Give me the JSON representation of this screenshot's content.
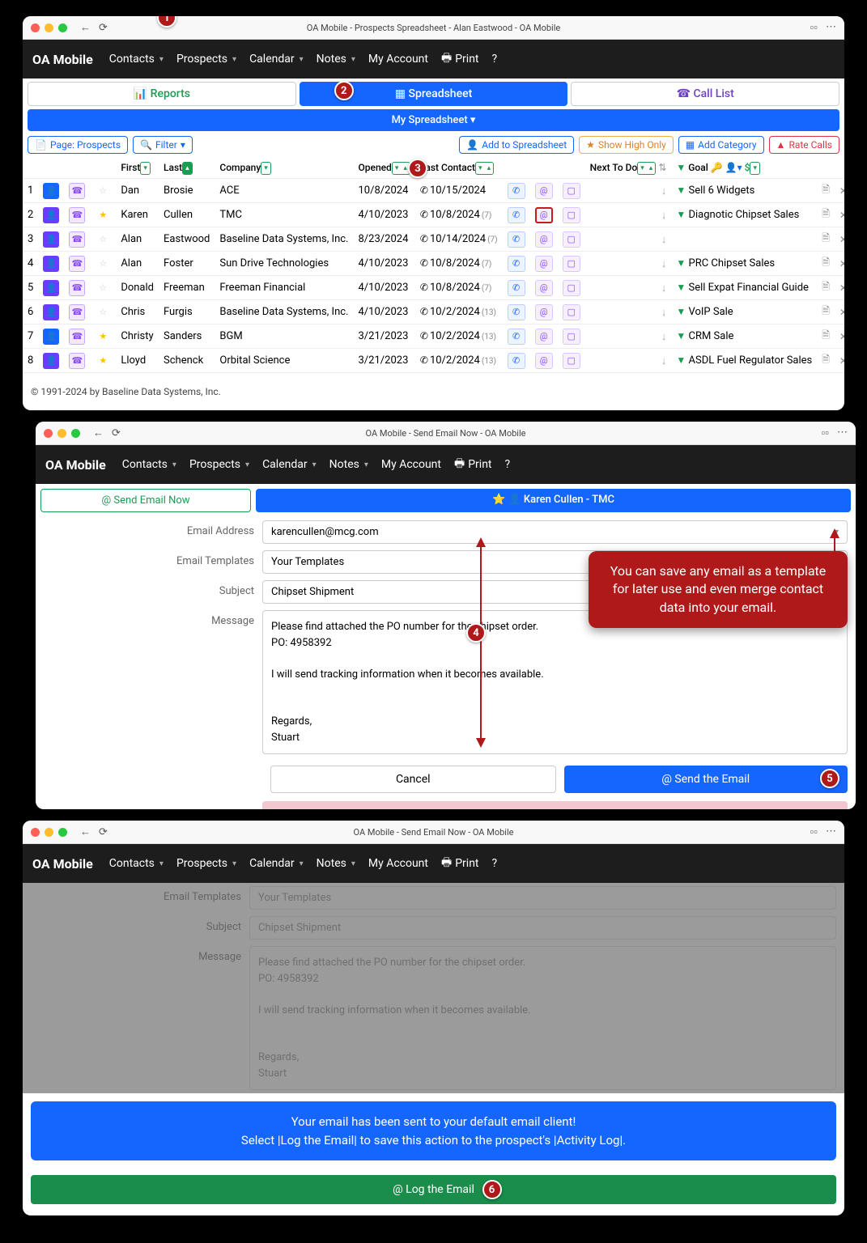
{
  "callouts": {
    "c1": "1",
    "c2": "2",
    "c3": "3",
    "c4": "4",
    "c5": "5",
    "c6": "6"
  },
  "tip1": "You can save any email as a template for later use and even merge contact data into your email.",
  "window1": {
    "title": "OA Mobile - Prospects Spreadsheet - Alan Eastwood - OA Mobile",
    "brand": "OA Mobile",
    "menu": {
      "contacts": "Contacts",
      "prospects": "Prospects",
      "calendar": "Calendar",
      "notes": "Notes",
      "account": "My Account",
      "print": "Print",
      "help": "?"
    },
    "tabs": {
      "reports": "Reports",
      "spreadsheet": "Spreadsheet",
      "calllist": "Call List"
    },
    "subbar": "My Spreadsheet",
    "toolbar": {
      "page": "Page: Prospects",
      "filter": "Filter",
      "add": "Add to Spreadsheet",
      "high": "Show High Only",
      "cat": "Add Category",
      "rate": "Rate Calls"
    },
    "headers": {
      "first": "First",
      "last": "Last",
      "company": "Company",
      "opened": "Opened",
      "lastcontact": "Last Contact",
      "next": "Next To Do",
      "goal": "Goal"
    },
    "rows": [
      {
        "n": "1",
        "pc": "blue",
        "star": false,
        "first": "Dan",
        "last": "Brosie",
        "company": "ACE",
        "opened": "10/8/2024",
        "contact": "10/15/2024",
        "cnt": "",
        "goal": "Sell 6 Widgets"
      },
      {
        "n": "2",
        "pc": "purple",
        "star": true,
        "first": "Karen",
        "last": "Cullen",
        "company": "TMC",
        "opened": "4/10/2023",
        "contact": "10/8/2024",
        "cnt": "(7)",
        "goal": "Diagnotic Chipset Sales",
        "hl": true
      },
      {
        "n": "3",
        "pc": "purple",
        "star": false,
        "first": "Alan",
        "last": "Eastwood",
        "company": "Baseline Data Systems, Inc.",
        "opened": "8/23/2024",
        "contact": "10/14/2024",
        "cnt": "(7)",
        "goal": ""
      },
      {
        "n": "4",
        "pc": "purple",
        "star": false,
        "first": "Alan",
        "last": "Foster",
        "company": "Sun Drive Technologies",
        "opened": "4/10/2023",
        "contact": "10/8/2024",
        "cnt": "(7)",
        "goal": "PRC Chipset Sales"
      },
      {
        "n": "5",
        "pc": "purple",
        "star": false,
        "first": "Donald",
        "last": "Freeman",
        "company": "Freeman Financial",
        "opened": "4/10/2023",
        "contact": "10/8/2024",
        "cnt": "(7)",
        "goal": "Sell Expat Financial Guide"
      },
      {
        "n": "6",
        "pc": "purple",
        "star": false,
        "first": "Chris",
        "last": "Furgis",
        "company": "Baseline Data Systems, Inc.",
        "opened": "4/10/2023",
        "contact": "10/2/2024",
        "cnt": "(13)",
        "goal": "VoIP Sale"
      },
      {
        "n": "7",
        "pc": "blue",
        "star": true,
        "first": "Christy",
        "last": "Sanders",
        "company": "BGM",
        "opened": "3/21/2023",
        "contact": "10/2/2024",
        "cnt": "(13)",
        "goal": "CRM Sale"
      },
      {
        "n": "8",
        "pc": "purple",
        "star": true,
        "first": "Lloyd",
        "last": "Schenck",
        "company": "Orbital Science",
        "opened": "3/21/2023",
        "contact": "10/2/2024",
        "cnt": "(13)",
        "goal": "ASDL Fuel Regulator Sales"
      }
    ],
    "copy": "© 1991-2024 by Baseline Data Systems, Inc."
  },
  "window2": {
    "title": "OA Mobile - Send Email Now - OA Mobile",
    "brand": "OA Mobile",
    "menu": {
      "contacts": "Contacts",
      "prospects": "Prospects",
      "calendar": "Calendar",
      "notes": "Notes",
      "account": "My Account",
      "print": "Print",
      "help": "?"
    },
    "sendnow": "Send Email Now",
    "contact": "Karen Cullen - TMC",
    "labels": {
      "email": "Email Address",
      "templates": "Email Templates",
      "subject": "Subject",
      "message": "Message"
    },
    "fields": {
      "email": "karencullen@mcg.com",
      "templates": "Your Templates",
      "subject": "Chipset Shipment",
      "message": "Please find attached the PO number for the chipset order.\nPO: 4958392\n\nI will send tracking information when it becomes available.\n\n\nRegards,\nStuart"
    },
    "buttons": {
      "cancel": "Cancel",
      "send": "Send the Email"
    }
  },
  "window3": {
    "title": "OA Mobile - Send Email Now - OA Mobile",
    "brand": "OA Mobile",
    "menu": {
      "contacts": "Contacts",
      "prospects": "Prospects",
      "calendar": "Calendar",
      "notes": "Notes",
      "account": "My Account",
      "print": "Print",
      "help": "?"
    },
    "labels": {
      "templates": "Email Templates",
      "subject": "Subject",
      "message": "Message"
    },
    "fields": {
      "templates": "Your Templates",
      "subject": "Chipset Shipment",
      "message": "Please find attached the PO number for the chipset order.\nPO: 4958392\n\nI will send tracking information when it becomes available.\n\n\nRegards,\nStuart"
    },
    "alert": "Your email has been sent to your default email client!\nSelect |Log the Email| to save this action to the prospect's |Activity Log|.",
    "log": "Log the Email"
  }
}
